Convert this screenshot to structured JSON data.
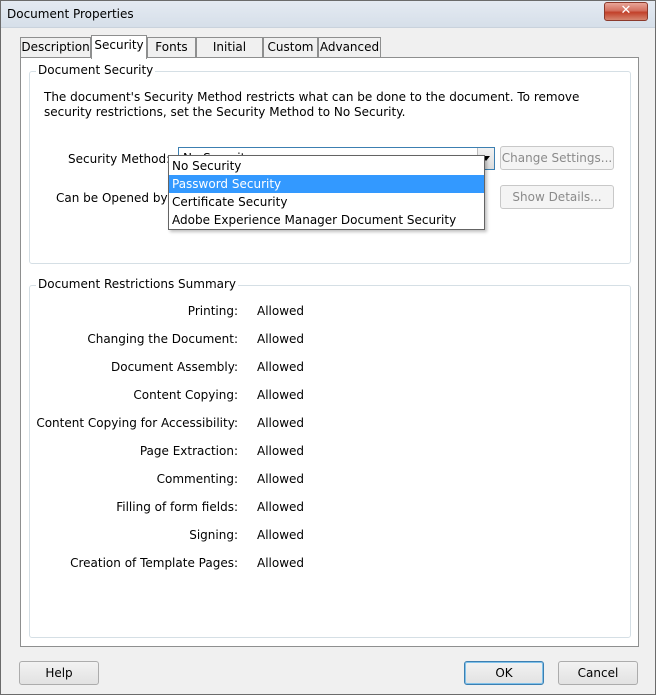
{
  "window": {
    "title": "Document Properties",
    "close_glyph": "✕"
  },
  "tabs": [
    {
      "label": "Description"
    },
    {
      "label": "Security",
      "active": true
    },
    {
      "label": "Fonts"
    },
    {
      "label": "Initial View"
    },
    {
      "label": "Custom"
    },
    {
      "label": "Advanced"
    }
  ],
  "security": {
    "group_title": "Document Security",
    "description": "The document's Security Method restricts what can be done to the document. To remove security restrictions, set the Security Method to No Security.",
    "method_label": "Security Method:",
    "method_value": "No Security",
    "opened_label": "Can be Opened by:",
    "change_settings_label": "Change Settings...",
    "show_details_label": "Show Details...",
    "dropdown_options": [
      {
        "label": "No Security"
      },
      {
        "label": "Password Security",
        "highlighted": true
      },
      {
        "label": "Certificate Security"
      },
      {
        "label": "Adobe Experience Manager Document Security"
      }
    ]
  },
  "restrictions": {
    "group_title": "Document Restrictions Summary",
    "rows": [
      {
        "label": "Printing:",
        "value": "Allowed"
      },
      {
        "label": "Changing the Document:",
        "value": "Allowed"
      },
      {
        "label": "Document Assembly:",
        "value": "Allowed"
      },
      {
        "label": "Content Copying:",
        "value": "Allowed"
      },
      {
        "label": "Content Copying for Accessibility:",
        "value": "Allowed"
      },
      {
        "label": "Page Extraction:",
        "value": "Allowed"
      },
      {
        "label": "Commenting:",
        "value": "Allowed"
      },
      {
        "label": "Filling of form fields:",
        "value": "Allowed"
      },
      {
        "label": "Signing:",
        "value": "Allowed"
      },
      {
        "label": "Creation of Template Pages:",
        "value": "Allowed"
      }
    ]
  },
  "footer": {
    "help_label": "Help",
    "ok_label": "OK",
    "cancel_label": "Cancel"
  },
  "colors": {
    "highlight": "#3399ff",
    "close_button": "#c2412a"
  }
}
